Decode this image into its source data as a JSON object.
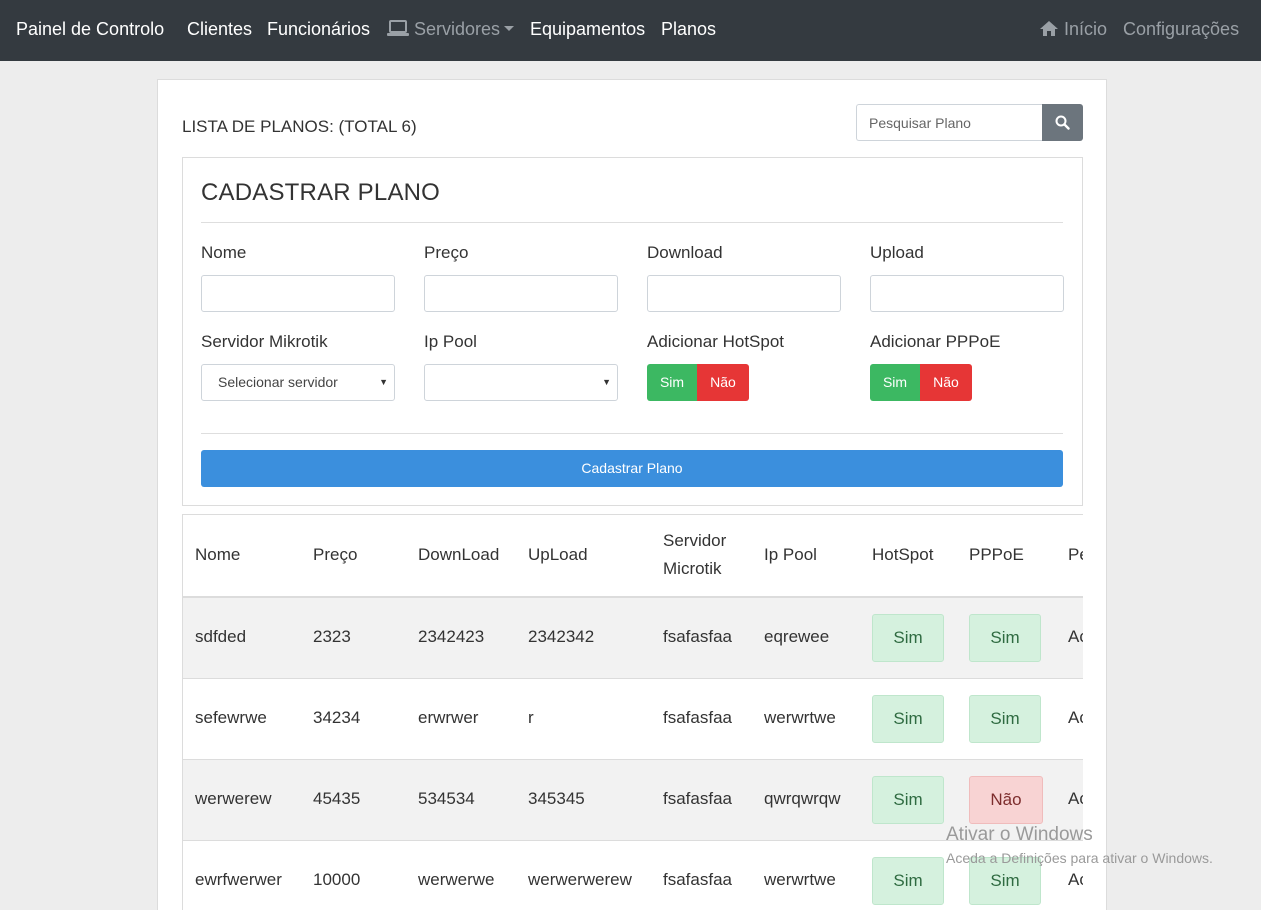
{
  "navbar": {
    "brand": "Painel de Controlo",
    "links": [
      "Clientes",
      "Funcionários",
      "Servidores",
      "Equipamentos",
      "Planos"
    ],
    "right_links": [
      "Início",
      "Configurações"
    ]
  },
  "list": {
    "title": "LISTA DE PLANOS: (TOTAL 6)",
    "search_placeholder": "Pesquisar Plano"
  },
  "form": {
    "title": "CADASTRAR PLANO",
    "labels": {
      "nome": "Nome",
      "preco": "Preço",
      "download": "Download",
      "upload": "Upload",
      "servidor": "Servidor Mikrotik",
      "ippool": "Ip Pool",
      "hotspot": "Adicionar HotSpot",
      "pppoe": "Adicionar PPPoE"
    },
    "servidor_select": "Selecionar servidor",
    "ippool_select": "",
    "toggle_yes": "Sim",
    "toggle_no": "Não",
    "submit": "Cadastrar Plano"
  },
  "table": {
    "headers": [
      "Nome",
      "Preço",
      "DownLoad",
      "UpLoad",
      "Servidor Microtik",
      "Ip Pool",
      "HotSpot",
      "PPPoE",
      "Pe"
    ],
    "rows": [
      {
        "nome": "sdfded",
        "preco": "2323",
        "download": "2342423",
        "upload": "2342342",
        "servidor": "fsafasfaa",
        "ippool": "eqrewee",
        "hotspot": "Sim",
        "pppoe": "Sim",
        "extra": "Ac"
      },
      {
        "nome": "sefewrwe",
        "preco": "34234",
        "download": "erwrwer",
        "upload": "r",
        "servidor": "fsafasfaa",
        "ippool": "werwrtwe",
        "hotspot": "Sim",
        "pppoe": "Sim",
        "extra": "Ac"
      },
      {
        "nome": "werwerew",
        "preco": "45435",
        "download": "534534",
        "upload": "345345",
        "servidor": "fsafasfaa",
        "ippool": "qwrqwrqw",
        "hotspot": "Sim",
        "pppoe": "Não",
        "extra": "Ac"
      },
      {
        "nome": "ewrfwerwer",
        "preco": "10000",
        "download": "werwerwe",
        "upload": "werwerwerew",
        "servidor": "fsafasfaa",
        "ippool": "werwrtwe",
        "hotspot": "Sim",
        "pppoe": "Sim",
        "extra": "Ac"
      }
    ]
  },
  "watermark": {
    "title": "Ativar o Windows",
    "subtitle": "Aceda a Definições para ativar o Windows."
  }
}
